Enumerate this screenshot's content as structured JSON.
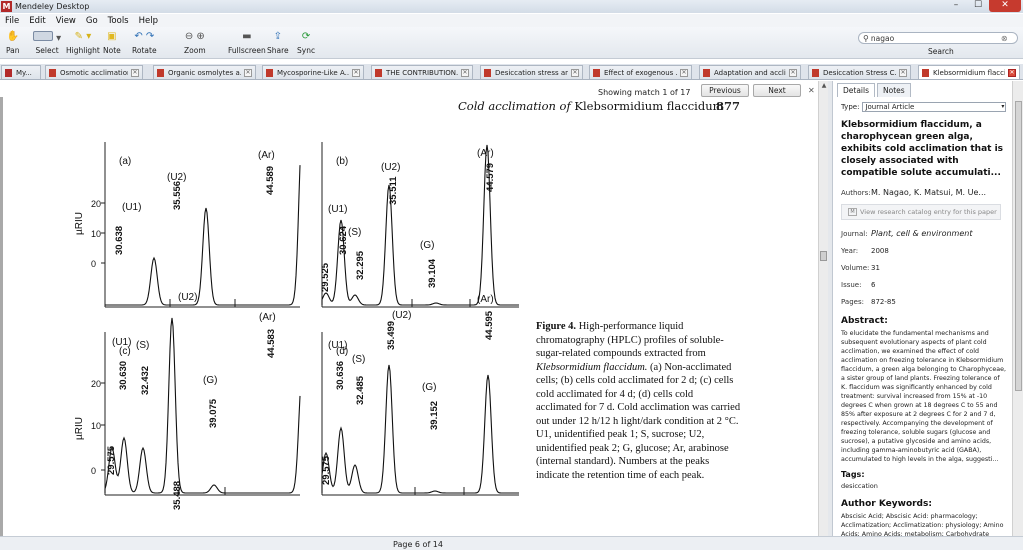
{
  "window": {
    "title": "Mendeley Desktop",
    "controls": [
      "–",
      "☐",
      "✕"
    ]
  },
  "menu": [
    "File",
    "Edit",
    "View",
    "Go",
    "Tools",
    "Help"
  ],
  "toolbar": {
    "tools": [
      "Pan",
      "Select",
      "Highlight",
      "Note",
      "Rotate",
      "Zoom",
      "Fullscreen",
      "Share",
      "Sync"
    ],
    "search_value": "nagao",
    "search_label": "Search"
  },
  "tabs": [
    "My...",
    "Osmotic acclimation...",
    "Organic osmolytes a...",
    "Mycosporine-Like A...",
    "THE CONTRIBUTION...",
    "Desiccation stress an...",
    "Effect of exogenous ...",
    "Adaptation and accli...",
    "Desiccation Stress C...",
    "Klebsormidium flacci..."
  ],
  "find": {
    "status": "Showing match 1 of 17",
    "previous": "Previous",
    "next": "Next"
  },
  "page": {
    "header_italic": "Cold acclimation of",
    "header_plain": "Klebsormidium flaccidum",
    "page_number": "877"
  },
  "figure": {
    "y_axis_label": "µRIU",
    "y_ticks": [
      "20",
      "10",
      "0"
    ],
    "panels": [
      {
        "id": "(a)",
        "peaks": [
          {
            "label": "(U1)",
            "time": "30.638"
          },
          {
            "label": "(U2)",
            "time": "35.556"
          },
          {
            "label": "(Ar)",
            "time": "44.589"
          }
        ]
      },
      {
        "id": "(b)",
        "peaks": [
          {
            "label": "",
            "time": "29.525"
          },
          {
            "label": "(U1)",
            "time": "30.624"
          },
          {
            "label": "(S)",
            "time": "32.295"
          },
          {
            "label": "(U2)",
            "time": "35.511"
          },
          {
            "label": "(G)",
            "time": "39.104"
          },
          {
            "label": "(Ar)",
            "time": "44.579"
          }
        ]
      },
      {
        "id": "(c)",
        "peaks": [
          {
            "label": "",
            "time": "29.575"
          },
          {
            "label": "(U1)",
            "time": "30.630"
          },
          {
            "label": "(S)",
            "time": "32.432"
          },
          {
            "label": "(U2)",
            "time": "35.488"
          },
          {
            "label": "(G)",
            "time": "39.075"
          },
          {
            "label": "(Ar)",
            "time": "44.583"
          }
        ]
      },
      {
        "id": "(d)",
        "peaks": [
          {
            "label": "",
            "time": "29.575"
          },
          {
            "label": "(U1)",
            "time": "30.636"
          },
          {
            "label": "(S)",
            "time": "32.485"
          },
          {
            "label": "(U2)",
            "time": "35.499"
          },
          {
            "label": "(G)",
            "time": "39.152"
          },
          {
            "label": "(Ar)",
            "time": "44.595"
          }
        ]
      }
    ],
    "caption_title": "Figure 4.",
    "caption_lead": "High-performance liquid chromatography (HPLC) profiles of soluble-sugar-related compounds extracted from",
    "caption_species": "Klebsormidium flaccidum.",
    "caption_rest": "(a) Non-acclimated cells; (b) cells cold acclimated for 2 d; (c) cells cold acclimated for 4 d; (d) cells cold acclimated for 7 d. Cold acclimation was carried out under 12 h/12 h light/dark condition at 2 °C. U1, unidentified peak 1; S, sucrose; U2, unidentified peak 2; G, glucose; Ar, arabinose (internal standard). Numbers at the peaks indicate the retention time of each peak."
  },
  "status": {
    "page_indicator": "Page 6 of 14"
  },
  "details": {
    "tabs": [
      "Details",
      "Notes"
    ],
    "type_label": "Type:",
    "type_value": "Journal Article",
    "title": "Klebsormidium flaccidum, a charophycean green alga, exhibits cold acclimation that is closely associated with compatible solute accumulati...",
    "authors_label": "Authors:",
    "authors": "M. Nagao, K. Matsui, M. Ue...",
    "catalog_link": "View research catalog entry for this paper",
    "fields": [
      {
        "label": "Journal:",
        "value": "Plant, cell & environment"
      },
      {
        "label": "Year:",
        "value": "2008"
      },
      {
        "label": "Volume:",
        "value": "31"
      },
      {
        "label": "Issue:",
        "value": "6"
      },
      {
        "label": "Pages:",
        "value": "872-85"
      }
    ],
    "abstract_heading": "Abstract:",
    "abstract": "To elucidate the fundamental mechanisms and subsequent evolutionary aspects of plant cold acclimation, we examined the effect of cold acclimation on freezing tolerance in Klebsormidium flaccidum, a green alga belonging to Charophyceae, a sister group of land plants. Freezing tolerance of K. flaccidum was significantly enhanced by cold treatment: survival increased from 15% at -10 degrees C when grown at 18 degrees C to 55 and 85% after exposure at 2 degrees C for 2 and 7 d, respectively. Accompanying the development of freezing tolerance, soluble sugars (glucose and sucrose), a putative glycoside and amino acids, including gamma-aminobutyric acid (GABA), accumulated to high levels in the alga, suggesti...",
    "tags_heading": "Tags:",
    "tags": "desiccation",
    "keywords_heading": "Author Keywords:",
    "keywords": "Abscisic Acid; Abscisic Acid: pharmacology; Acclimatization; Acclimatization: physiology; Amino Acids; Amino Acids: metabolism; Carbohydrate Metabolism; Carbohydrates; Carbohydrates: chemistry; Chlorophyta; Chloro..."
  }
}
